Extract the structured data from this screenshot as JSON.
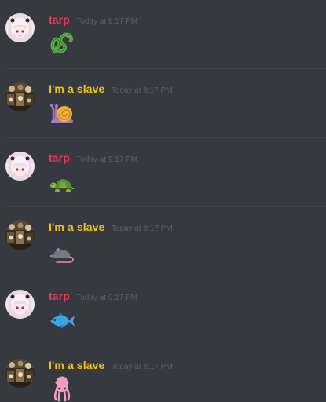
{
  "messages": [
    {
      "author": "tarp",
      "timestamp": "Today at 9:17 PM",
      "emoji": "snake"
    },
    {
      "author": "I'm a slave",
      "timestamp": "Today at 9:17 PM",
      "emoji": "snail"
    },
    {
      "author": "tarp",
      "timestamp": "Today at 9:17 PM",
      "emoji": "turtle"
    },
    {
      "author": "I'm a slave",
      "timestamp": "Today at 9:17 PM",
      "emoji": "rat"
    },
    {
      "author": "tarp",
      "timestamp": "Today at 9:17 PM",
      "emoji": "fish"
    },
    {
      "author": "I'm a slave",
      "timestamp": "Today at 9:17 PM",
      "emoji": "squid"
    }
  ],
  "colors": {
    "background": "#36393f",
    "tarp_name": "#e8395b",
    "slave_name": "#f1c40f",
    "timestamp": "#5d6067"
  }
}
